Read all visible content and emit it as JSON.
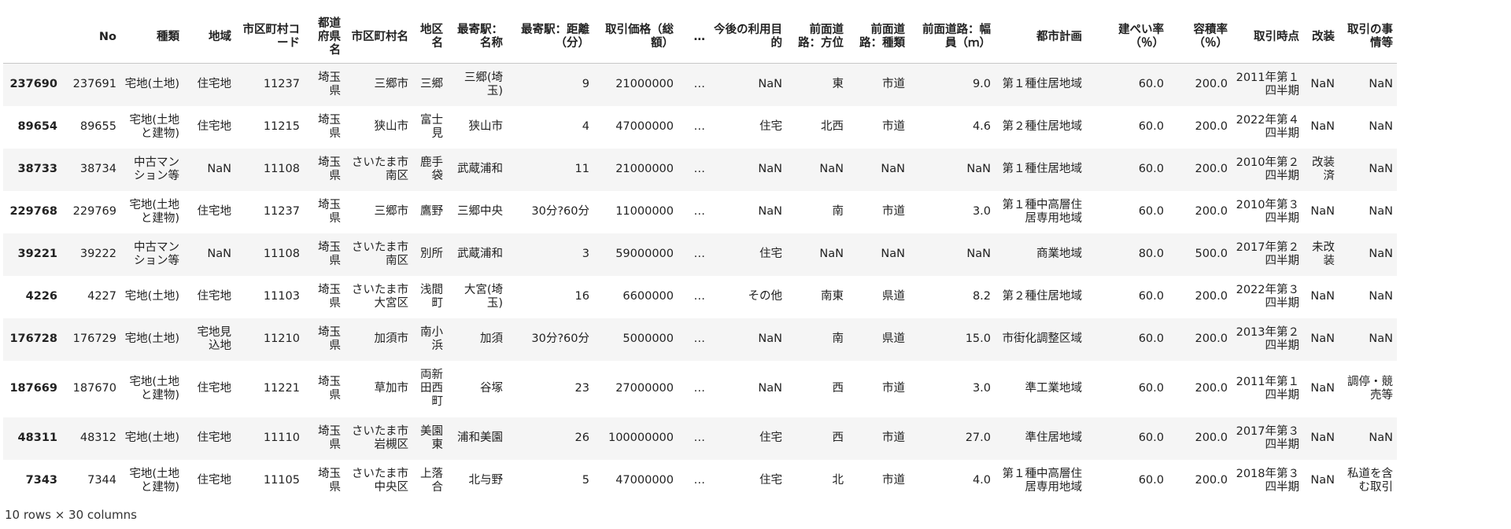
{
  "table": {
    "index_header": "",
    "columns": [
      "No",
      "種類",
      "地域",
      "市区町村コード",
      "都道府県名",
      "市区町村名",
      "地区名",
      "最寄駅：名称",
      "最寄駅：距離（分）",
      "取引価格（総額）",
      "…",
      "今後の利用目的",
      "前面道路：方位",
      "前面道路：種類",
      "前面道路：幅員（ｍ）",
      "都市計画",
      "建ぺい率（％）",
      "容積率（％）",
      "取引時点",
      "改装",
      "取引の事情等"
    ],
    "rows": [
      {
        "index": "237690",
        "cells": [
          "237691",
          "宅地(土地)",
          "住宅地",
          "11237",
          "埼玉県",
          "三郷市",
          "三郷",
          "三郷(埼玉)",
          "9",
          "21000000",
          "…",
          "NaN",
          "東",
          "市道",
          "9.0",
          "第１種住居地域",
          "60.0",
          "200.0",
          "2011年第１四半期",
          "NaN",
          "NaN"
        ]
      },
      {
        "index": "89654",
        "cells": [
          "89655",
          "宅地(土地と建物)",
          "住宅地",
          "11215",
          "埼玉県",
          "狭山市",
          "富士見",
          "狭山市",
          "4",
          "47000000",
          "…",
          "住宅",
          "北西",
          "市道",
          "4.6",
          "第２種住居地域",
          "60.0",
          "200.0",
          "2022年第４四半期",
          "NaN",
          "NaN"
        ]
      },
      {
        "index": "38733",
        "cells": [
          "38734",
          "中古マンション等",
          "NaN",
          "11108",
          "埼玉県",
          "さいたま市南区",
          "鹿手袋",
          "武蔵浦和",
          "11",
          "21000000",
          "…",
          "NaN",
          "NaN",
          "NaN",
          "NaN",
          "第１種住居地域",
          "60.0",
          "200.0",
          "2010年第２四半期",
          "改装済",
          "NaN"
        ]
      },
      {
        "index": "229768",
        "cells": [
          "229769",
          "宅地(土地と建物)",
          "住宅地",
          "11237",
          "埼玉県",
          "三郷市",
          "鷹野",
          "三郷中央",
          "30分?60分",
          "11000000",
          "…",
          "NaN",
          "南",
          "市道",
          "3.0",
          "第１種中高層住居専用地域",
          "60.0",
          "200.0",
          "2010年第３四半期",
          "NaN",
          "NaN"
        ]
      },
      {
        "index": "39221",
        "cells": [
          "39222",
          "中古マンション等",
          "NaN",
          "11108",
          "埼玉県",
          "さいたま市南区",
          "別所",
          "武蔵浦和",
          "3",
          "59000000",
          "…",
          "住宅",
          "NaN",
          "NaN",
          "NaN",
          "商業地域",
          "80.0",
          "500.0",
          "2017年第２四半期",
          "未改装",
          "NaN"
        ]
      },
      {
        "index": "4226",
        "cells": [
          "4227",
          "宅地(土地)",
          "住宅地",
          "11103",
          "埼玉県",
          "さいたま市大宮区",
          "浅間町",
          "大宮(埼玉)",
          "16",
          "6600000",
          "…",
          "その他",
          "南東",
          "県道",
          "8.2",
          "第２種住居地域",
          "60.0",
          "200.0",
          "2022年第３四半期",
          "NaN",
          "NaN"
        ]
      },
      {
        "index": "176728",
        "cells": [
          "176729",
          "宅地(土地)",
          "宅地見込地",
          "11210",
          "埼玉県",
          "加須市",
          "南小浜",
          "加須",
          "30分?60分",
          "5000000",
          "…",
          "NaN",
          "南",
          "県道",
          "15.0",
          "市街化調整区域",
          "60.0",
          "200.0",
          "2013年第２四半期",
          "NaN",
          "NaN"
        ]
      },
      {
        "index": "187669",
        "cells": [
          "187670",
          "宅地(土地と建物)",
          "住宅地",
          "11221",
          "埼玉県",
          "草加市",
          "両新田西町",
          "谷塚",
          "23",
          "27000000",
          "…",
          "NaN",
          "西",
          "市道",
          "3.0",
          "準工業地域",
          "60.0",
          "200.0",
          "2011年第１四半期",
          "NaN",
          "調停・競売等"
        ]
      },
      {
        "index": "48311",
        "cells": [
          "48312",
          "宅地(土地)",
          "住宅地",
          "11110",
          "埼玉県",
          "さいたま市岩槻区",
          "美園東",
          "浦和美園",
          "26",
          "100000000",
          "…",
          "住宅",
          "西",
          "市道",
          "27.0",
          "準住居地域",
          "60.0",
          "200.0",
          "2017年第３四半期",
          "NaN",
          "NaN"
        ]
      },
      {
        "index": "7343",
        "cells": [
          "7344",
          "宅地(土地と建物)",
          "住宅地",
          "11105",
          "埼玉県",
          "さいたま市中央区",
          "上落合",
          "北与野",
          "5",
          "47000000",
          "…",
          "住宅",
          "北",
          "市道",
          "4.0",
          "第１種中高層住居専用地域",
          "60.0",
          "200.0",
          "2018年第３四半期",
          "NaN",
          "私道を含む取引"
        ]
      }
    ]
  },
  "footer": "10 rows × 30 columns"
}
